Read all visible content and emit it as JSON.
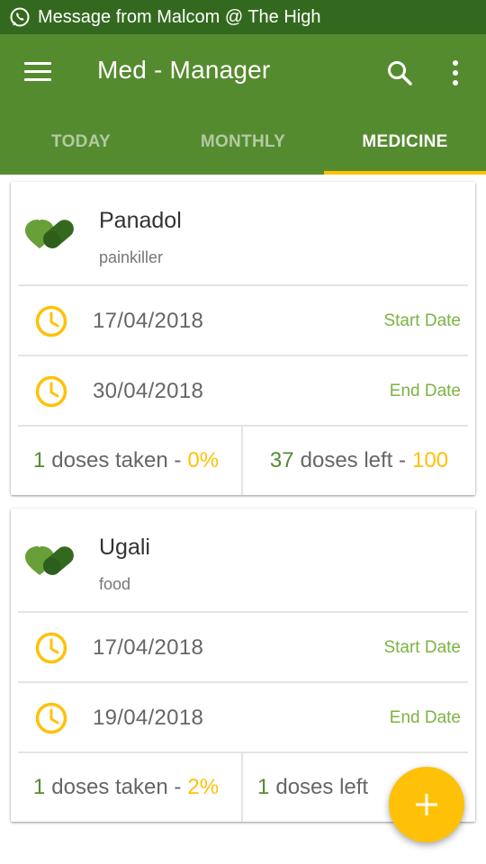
{
  "status_bar": {
    "notification": "Message from Malcom @ The High",
    "icon": "whatsapp-icon"
  },
  "app_bar": {
    "title": "Med - Manager",
    "menu_icon": "hamburger-menu-icon",
    "search_icon": "search-icon",
    "overflow_icon": "more-vertical-icon",
    "background_color": "#558b2f",
    "status_color": "#33691e",
    "accent_color": "#ffc107"
  },
  "tabs": [
    {
      "label": "TODAY",
      "active": false
    },
    {
      "label": "MONTHLY",
      "active": false
    },
    {
      "label": "MEDICINE",
      "active": true
    }
  ],
  "medicines": [
    {
      "name": "Panadol",
      "type": "painkiller",
      "icon": "pill-icon",
      "start_date": "17/04/2018",
      "start_label": "Start Date",
      "end_date": "30/04/2018",
      "end_label": "End Date",
      "doses_taken_count": "1",
      "doses_taken_text": "doses taken -",
      "doses_taken_percent": "0%",
      "doses_left_count": "37",
      "doses_left_text": "doses left -",
      "doses_left_percent": "100"
    },
    {
      "name": "Ugali",
      "type": "food",
      "icon": "pill-icon",
      "start_date": "17/04/2018",
      "start_label": "Start Date",
      "end_date": "19/04/2018",
      "end_label": "End Date",
      "doses_taken_count": "1",
      "doses_taken_text": "doses taken -",
      "doses_taken_percent": "2%",
      "doses_left_count": "1",
      "doses_left_text": "doses left",
      "doses_left_percent": ""
    }
  ],
  "fab": {
    "label": "+",
    "icon": "add-icon"
  }
}
